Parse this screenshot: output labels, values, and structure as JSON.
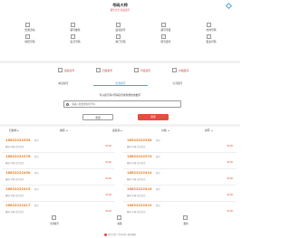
{
  "header": {
    "title": "号码大师",
    "subtitle": "靓号大全 欢迎选号"
  },
  "grid_items": [
    {
      "label": "优惠活动",
      "icon": "gift-icon"
    },
    {
      "label": "靓号推荐",
      "icon": "star-icon"
    },
    {
      "label": "运营商号",
      "icon": "tower-icon"
    },
    {
      "label": "靓号专区",
      "icon": "crown-icon"
    },
    {
      "label": "吉祥号码",
      "icon": "lucky-icon"
    },
    {
      "label": "情侣号码",
      "icon": "heart-icon"
    },
    {
      "label": "生日号码",
      "icon": "cake-icon"
    },
    {
      "label": "热门号码",
      "icon": "fire-icon"
    },
    {
      "label": "尾号选号",
      "icon": "search-icon"
    },
    {
      "label": "更多号码",
      "icon": "more-icon"
    }
  ],
  "filter_row": [
    {
      "label": "运营商号"
    },
    {
      "label": "归属地号"
    },
    {
      "label": "号段选号"
    },
    {
      "label": "价格区间"
    }
  ],
  "tabs": [
    {
      "label": "精选靓号"
    },
    {
      "label": "优惠靓号"
    },
    {
      "label": "全部靓号"
    }
  ],
  "hint": "可以按号码/号码段查找你想找的数字",
  "search": {
    "placeholder": "请输入您要搜索的号码"
  },
  "buttons": {
    "reset": "重置",
    "search": "搜索"
  },
  "sort": [
    {
      "label": "归属地"
    },
    {
      "label": "类别"
    },
    {
      "label": "运营商"
    },
    {
      "label": "价格"
    },
    {
      "label": "排序"
    }
  ],
  "cards": [
    {
      "number": "18622222334",
      "tag": "靓号",
      "desc": "移动 中国 北京北京",
      "price": "¥100"
    },
    {
      "number": "18522222354",
      "tag": "靓号",
      "desc": "移动 中国 北京北京",
      "price": "¥100"
    },
    {
      "number": "18622222378",
      "tag": "靓号",
      "desc": "移动 中国 北京北京",
      "price": "¥100"
    },
    {
      "number": "18622222374",
      "tag": "靓号",
      "desc": "移动 中国 北京北京",
      "price": "¥100"
    },
    {
      "number": "18622222430",
      "tag": "靓号",
      "desc": "移动 中国 北京北京",
      "price": "¥100"
    },
    {
      "number": "18622222414",
      "tag": "靓号",
      "desc": "移动 中国 北京北京",
      "price": "¥100"
    },
    {
      "number": "18622222415",
      "tag": "靓号",
      "desc": "移动 中国 北京北京",
      "price": "¥100"
    },
    {
      "number": "18622222416",
      "tag": "靓号",
      "desc": "移动 中国 北京北京",
      "price": "¥100"
    },
    {
      "number": "18622222417",
      "tag": "靓号",
      "desc": "移动 中国 北京北京",
      "price": "¥100"
    },
    {
      "number": "18622222419",
      "tag": "靓号",
      "desc": "移动 中国 北京北京",
      "price": "¥100"
    }
  ],
  "bottom_nav": [
    {
      "label": "全部靓号",
      "icon": "grid-icon"
    },
    {
      "label": "客服",
      "icon": "service-icon"
    },
    {
      "label": "我的",
      "icon": "user-icon"
    }
  ],
  "footer": "靓号大师 | 手机号码 | 联系客服"
}
